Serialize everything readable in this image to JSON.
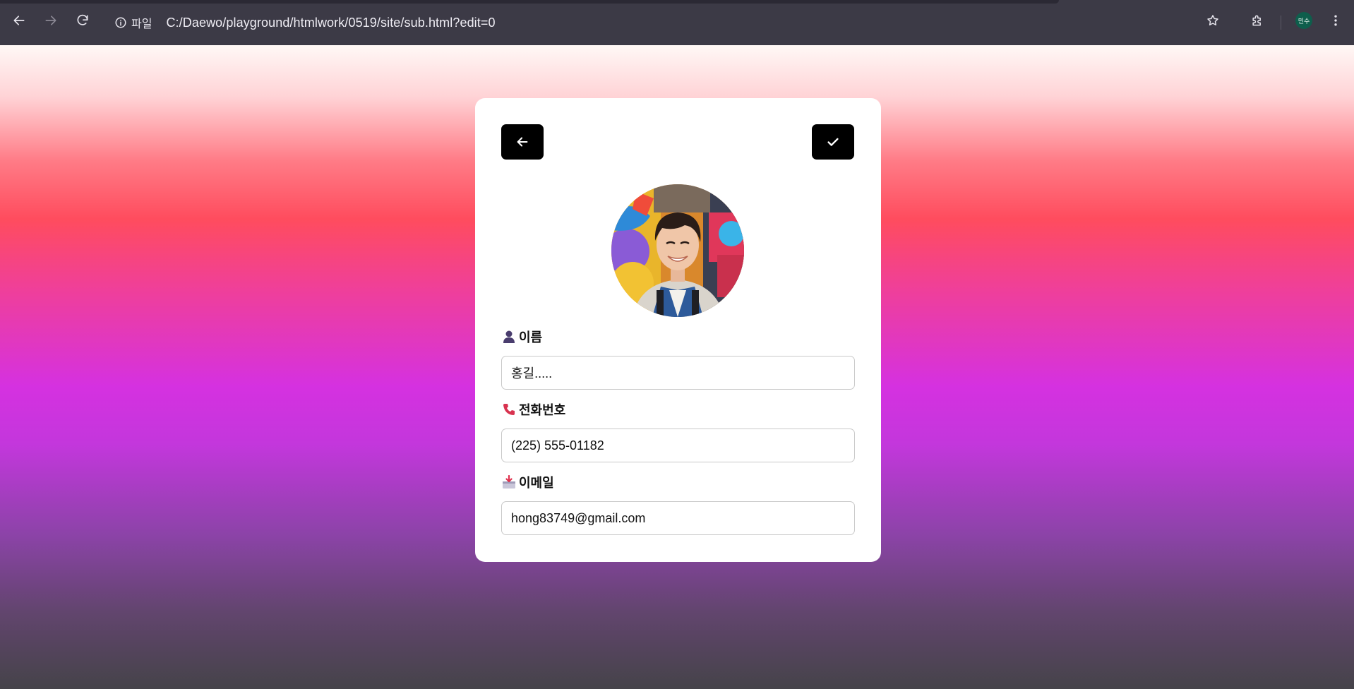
{
  "browser": {
    "site_info_label": "파일",
    "url": "C:/Daewo/playground/htmlwork/0519/site/sub.html?edit=0",
    "profile_badge": "민수",
    "icons": [
      "back-icon",
      "forward-icon",
      "reload-icon",
      "info-icon",
      "star-icon",
      "extensions-icon",
      "more-icon"
    ]
  },
  "card": {
    "back_button_icon": "arrow-left-icon",
    "save_button_icon": "check-icon",
    "fields": {
      "name": {
        "icon": "person-icon",
        "label": "이름",
        "value": "홍길....."
      },
      "phone": {
        "icon": "phone-icon",
        "label": "전화번호",
        "value": "(225) 555-01182"
      },
      "email": {
        "icon": "inbox-icon",
        "label": "이메일",
        "value": "hong83749@gmail.com"
      }
    }
  },
  "colors": {
    "chrome_bg": "#3c3a46",
    "card_bg": "#ffffff",
    "button_bg": "#000000",
    "gradient": [
      "#fff8f6",
      "#ff4c5e",
      "#d531e0",
      "#454349"
    ]
  }
}
